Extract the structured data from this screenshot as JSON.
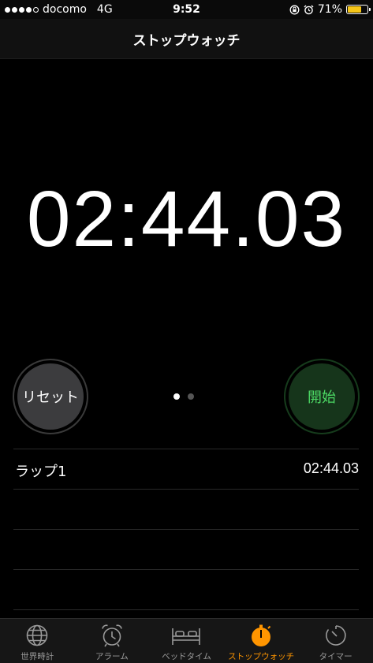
{
  "status_bar": {
    "carrier": "docomo",
    "network": "4G",
    "time": "9:52",
    "battery_percent": "71%",
    "battery_level": 0.71,
    "signal_bars_filled": 4,
    "signal_bars_total": 5,
    "icons": [
      "rotation-lock-icon",
      "alarm-icon",
      "battery-icon"
    ]
  },
  "nav": {
    "title": "ストップウォッチ"
  },
  "display": {
    "time": "02:44.03"
  },
  "controls": {
    "reset_label": "リセット",
    "start_label": "開始",
    "page_count": 2,
    "active_page": 1
  },
  "laps": [
    {
      "label": "ラップ1",
      "time": "02:44.03"
    }
  ],
  "tabs": [
    {
      "label": "世界時計",
      "icon": "globe-icon",
      "active": false
    },
    {
      "label": "アラーム",
      "icon": "alarm-clock-icon",
      "active": false
    },
    {
      "label": "ベッドタイム",
      "icon": "bed-icon",
      "active": false
    },
    {
      "label": "ストップウォッチ",
      "icon": "stopwatch-icon",
      "active": true
    },
    {
      "label": "タイマー",
      "icon": "timer-icon",
      "active": false
    }
  ],
  "colors": {
    "accent": "#ff9500",
    "start_text": "#4cd964",
    "start_bg": "#16351b",
    "reset_bg": "#3c3c3e",
    "battery": "#f5c518",
    "inactive_tab": "#9a9a9a"
  }
}
